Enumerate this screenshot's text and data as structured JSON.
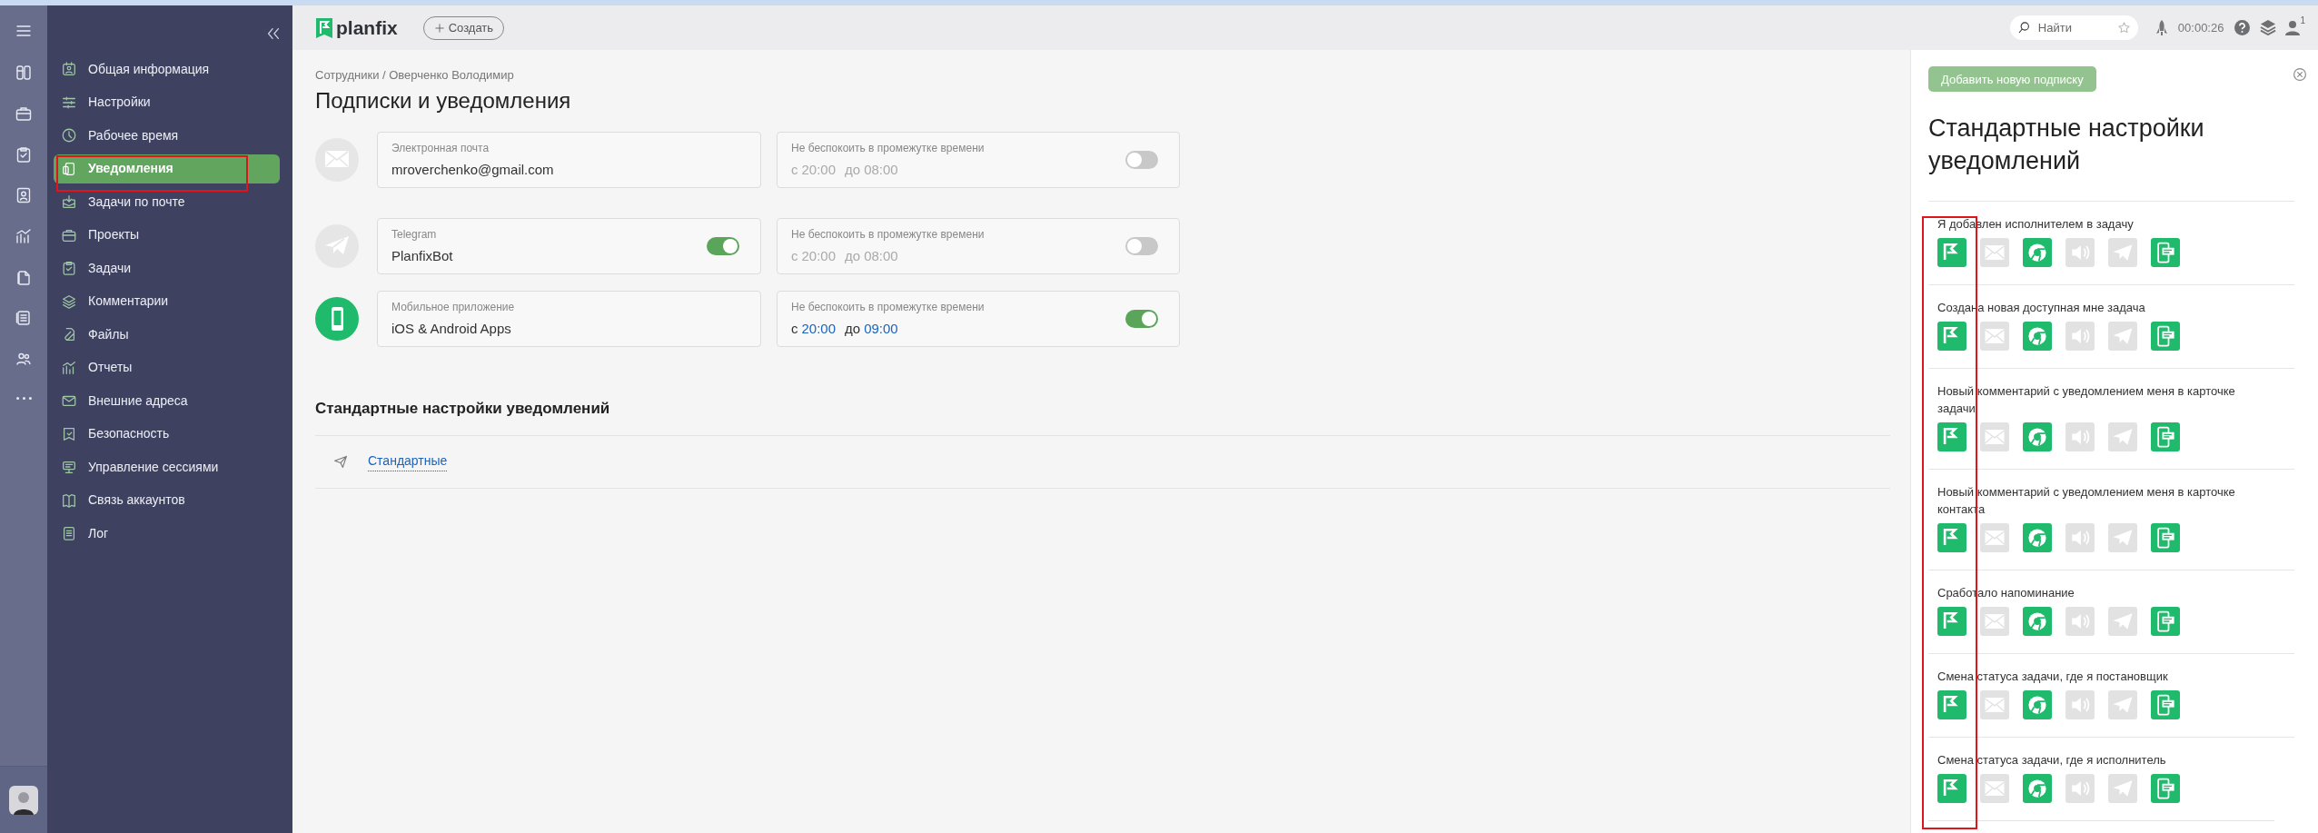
{
  "topbar": {
    "logo": "planfix",
    "create_button": "Создать",
    "search": {
      "placeholder": "Найти"
    },
    "timer": "00:00:26",
    "user_badge": "1"
  },
  "sidebar": {
    "items": [
      {
        "label": "Общая информация",
        "selected": false
      },
      {
        "label": "Настройки",
        "selected": false
      },
      {
        "label": "Рабочее время",
        "selected": false
      },
      {
        "label": "Уведомления",
        "selected": true
      },
      {
        "label": "Задачи по почте",
        "selected": false
      },
      {
        "label": "Проекты",
        "selected": false
      },
      {
        "label": "Задачи",
        "selected": false
      },
      {
        "label": "Комментарии",
        "selected": false
      },
      {
        "label": "Файлы",
        "selected": false
      },
      {
        "label": "Отчеты",
        "selected": false
      },
      {
        "label": "Внешние адреса",
        "selected": false
      },
      {
        "label": "Безопасность",
        "selected": false
      },
      {
        "label": "Управление сессиями",
        "selected": false
      },
      {
        "label": "Связь аккаунтов",
        "selected": false
      },
      {
        "label": "Лог",
        "selected": false
      }
    ]
  },
  "main": {
    "breadcrumb": "Сотрудники / Оверченко Володимир",
    "title": "Подписки и уведомления",
    "channels": [
      {
        "kind": "email",
        "active": false,
        "label": "Электронная почта",
        "value": "mroverchenko@gmail.com",
        "dnd": {
          "label": "Не беспокоить в промежутке времени",
          "on": false,
          "from_prefix": "с",
          "from": "20:00",
          "to_prefix": "до",
          "to": "08:00"
        }
      },
      {
        "kind": "telegram",
        "active": false,
        "label": "Telegram",
        "value": "PlanfixBot",
        "enabled": true,
        "dnd": {
          "label": "Не беспокоить в промежутке времени",
          "on": false,
          "from_prefix": "с",
          "from": "20:00",
          "to_prefix": "до",
          "to": "08:00"
        }
      },
      {
        "kind": "mobile",
        "active": true,
        "label": "Мобильное приложение",
        "value": "iOS & Android Apps",
        "dnd": {
          "label": "Не беспокоить в промежутке времени",
          "on": true,
          "from_prefix": "с",
          "from": "20:00",
          "to_prefix": "до",
          "to": "09:00"
        }
      }
    ],
    "section_title": "Стандартные настройки уведомлений",
    "subscription_link": "Стандартные"
  },
  "panel": {
    "add_button": "Добавить новую подписку",
    "title": "Стандартные настройки уведомлений",
    "events": [
      {
        "label": "Я добавлен исполнителем в задачу",
        "channels": [
          {
            "kind": "planfix",
            "on": true
          },
          {
            "kind": "email",
            "on": false
          },
          {
            "kind": "browser",
            "on": true
          },
          {
            "kind": "sound",
            "on": false
          },
          {
            "kind": "telegram",
            "on": false
          },
          {
            "kind": "mobile",
            "on": true
          }
        ]
      },
      {
        "label": "Создана новая доступная мне задача",
        "channels": [
          {
            "kind": "planfix",
            "on": true
          },
          {
            "kind": "email",
            "on": false
          },
          {
            "kind": "browser",
            "on": true
          },
          {
            "kind": "sound",
            "on": false
          },
          {
            "kind": "telegram",
            "on": false
          },
          {
            "kind": "mobile",
            "on": true
          }
        ]
      },
      {
        "label": "Новый комментарий с уведомлением меня в карточке задачи",
        "channels": [
          {
            "kind": "planfix",
            "on": true
          },
          {
            "kind": "email",
            "on": false
          },
          {
            "kind": "browser",
            "on": true
          },
          {
            "kind": "sound",
            "on": false
          },
          {
            "kind": "telegram",
            "on": false
          },
          {
            "kind": "mobile",
            "on": true
          }
        ]
      },
      {
        "label": "Новый комментарий с уведомлением меня в карточке контакта",
        "channels": [
          {
            "kind": "planfix",
            "on": true
          },
          {
            "kind": "email",
            "on": false
          },
          {
            "kind": "browser",
            "on": true
          },
          {
            "kind": "sound",
            "on": false
          },
          {
            "kind": "telegram",
            "on": false
          },
          {
            "kind": "mobile",
            "on": true
          }
        ]
      },
      {
        "label": "Сработало напоминание",
        "channels": [
          {
            "kind": "planfix",
            "on": true
          },
          {
            "kind": "email",
            "on": false
          },
          {
            "kind": "browser",
            "on": true
          },
          {
            "kind": "sound",
            "on": false
          },
          {
            "kind": "telegram",
            "on": false
          },
          {
            "kind": "mobile",
            "on": true
          }
        ]
      },
      {
        "label": "Смена статуса задачи, где я постановщик",
        "channels": [
          {
            "kind": "planfix",
            "on": true
          },
          {
            "kind": "email",
            "on": false
          },
          {
            "kind": "browser",
            "on": true
          },
          {
            "kind": "sound",
            "on": false
          },
          {
            "kind": "telegram",
            "on": false
          },
          {
            "kind": "mobile",
            "on": true
          }
        ]
      },
      {
        "label": "Смена статуса задачи, где я исполнитель",
        "channels": [
          {
            "kind": "planfix",
            "on": true
          },
          {
            "kind": "email",
            "on": false
          },
          {
            "kind": "browser",
            "on": true
          },
          {
            "kind": "sound",
            "on": false
          },
          {
            "kind": "telegram",
            "on": false
          },
          {
            "kind": "mobile",
            "on": true
          }
        ]
      }
    ]
  }
}
